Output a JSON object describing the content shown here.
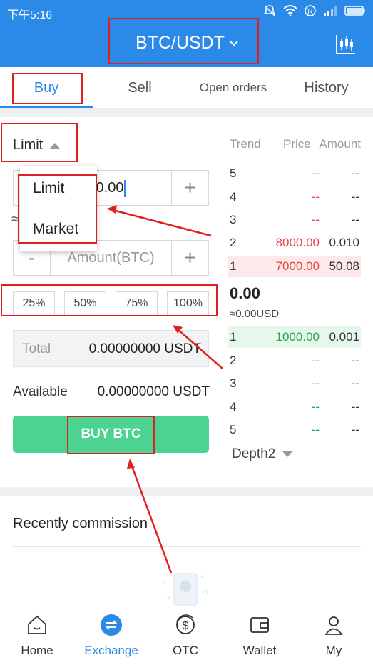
{
  "status_bar": {
    "time": "下午5:16",
    "icons": [
      "mute-icon",
      "wifi-icon",
      "registered-icon",
      "signal-icon",
      "battery-icon"
    ]
  },
  "header": {
    "pair": "BTC/USDT",
    "chart_icon": "candlestick-chart-icon",
    "bg_color": "#2b8ae8"
  },
  "tabs": [
    {
      "label": "Buy",
      "active": true
    },
    {
      "label": "Sell",
      "active": false
    },
    {
      "label": "Open orders",
      "active": false
    },
    {
      "label": "History",
      "active": false
    }
  ],
  "order_form": {
    "order_type": "Limit",
    "price_value": "0.00",
    "approx_symbol": "≈",
    "amount_placeholder": "Amount(BTC)",
    "minus": "-",
    "plus": "+",
    "percent_buttons": [
      "25%",
      "50%",
      "75%",
      "100%"
    ],
    "total_label": "Total",
    "total_value": "0.00000000 USDT",
    "available_label": "Available",
    "available_value": "0.00000000 USDT",
    "buy_label": "BUY BTC"
  },
  "order_type_dropdown": {
    "options": [
      "Limit",
      "Market"
    ]
  },
  "order_book": {
    "headers": {
      "trend": "Trend",
      "price": "Price",
      "amount": "Amount"
    },
    "asks": [
      {
        "level": "5",
        "price": "--",
        "amount": "--"
      },
      {
        "level": "4",
        "price": "--",
        "amount": "--"
      },
      {
        "level": "3",
        "price": "--",
        "amount": "--"
      },
      {
        "level": "2",
        "price": "8000.00",
        "amount": "0.010"
      },
      {
        "level": "1",
        "price": "7000.00",
        "amount": "50.08"
      }
    ],
    "last_price": "0.00",
    "last_price_fiat": "≈0.00USD",
    "bids": [
      {
        "level": "1",
        "price": "1000.00",
        "amount": "0.001"
      },
      {
        "level": "2",
        "price": "--",
        "amount": "--"
      },
      {
        "level": "3",
        "price": "--",
        "amount": "--"
      },
      {
        "level": "4",
        "price": "--",
        "amount": "--"
      },
      {
        "level": "5",
        "price": "--",
        "amount": "--"
      }
    ],
    "depth_label": "Depth2",
    "ask_color": "#e94545",
    "bid_color": "#21a84d"
  },
  "recent": {
    "title": "Recently commission"
  },
  "bottom_nav": [
    {
      "label": "Home",
      "icon": "home-icon",
      "active": false
    },
    {
      "label": "Exchange",
      "icon": "exchange-icon",
      "active": true
    },
    {
      "label": "OTC",
      "icon": "dollar-icon",
      "active": false
    },
    {
      "label": "Wallet",
      "icon": "wallet-icon",
      "active": false
    },
    {
      "label": "My",
      "icon": "user-icon",
      "active": false
    }
  ]
}
